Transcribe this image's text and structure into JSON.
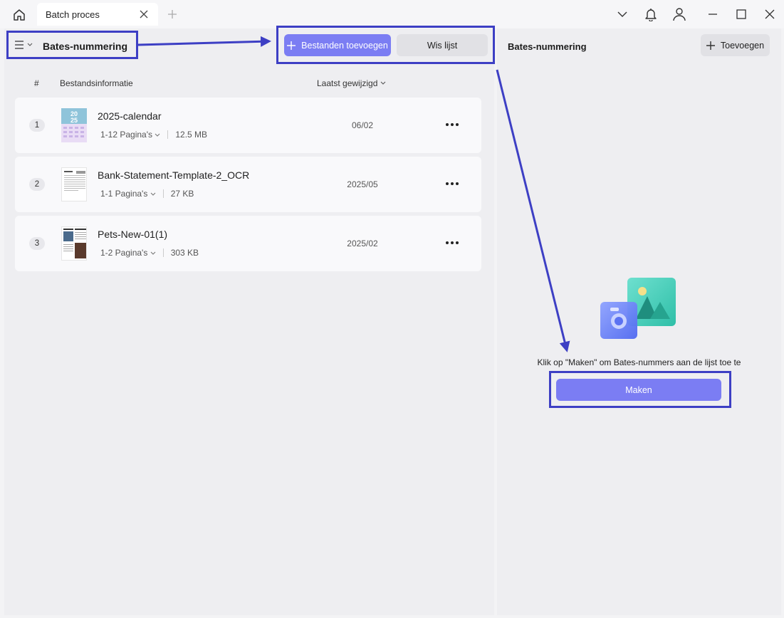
{
  "window": {
    "tab_title": "Batch proces",
    "home_icon": "home-icon",
    "controls": [
      "chevron-down-icon",
      "bell-icon",
      "user-icon",
      "minimize-icon",
      "maximize-icon",
      "close-icon"
    ]
  },
  "toolbar": {
    "title": "Bates-nummering",
    "add_files_label": "Bestanden toevoegen",
    "clear_list_label": "Wis lijst"
  },
  "list": {
    "columns": {
      "num": "#",
      "info": "Bestandsinformatie",
      "modified": "Laatst gewijzigd"
    },
    "files": [
      {
        "num": "1",
        "name": "2025-calendar",
        "pages": "1-12 Pagina's",
        "size": "12.5 MB",
        "date": "06/02"
      },
      {
        "num": "2",
        "name": "Bank-Statement-Template-2_OCR",
        "pages": "1-1 Pagina's",
        "size": "27 KB",
        "date": "2025/05"
      },
      {
        "num": "3",
        "name": "Pets-New-01(1)",
        "pages": "1-2 Pagina's",
        "size": "303 KB",
        "date": "2025/02"
      }
    ]
  },
  "right_panel": {
    "title": "Bates-nummering",
    "add_label": "Toevoegen",
    "hint": "Klik op \"Maken\" om Bates-nummers aan de lijst toe te",
    "make_label": "Maken"
  },
  "colors": {
    "accent": "#7b7df3",
    "highlight": "#3d3fc4",
    "panel": "#eeeef1"
  }
}
